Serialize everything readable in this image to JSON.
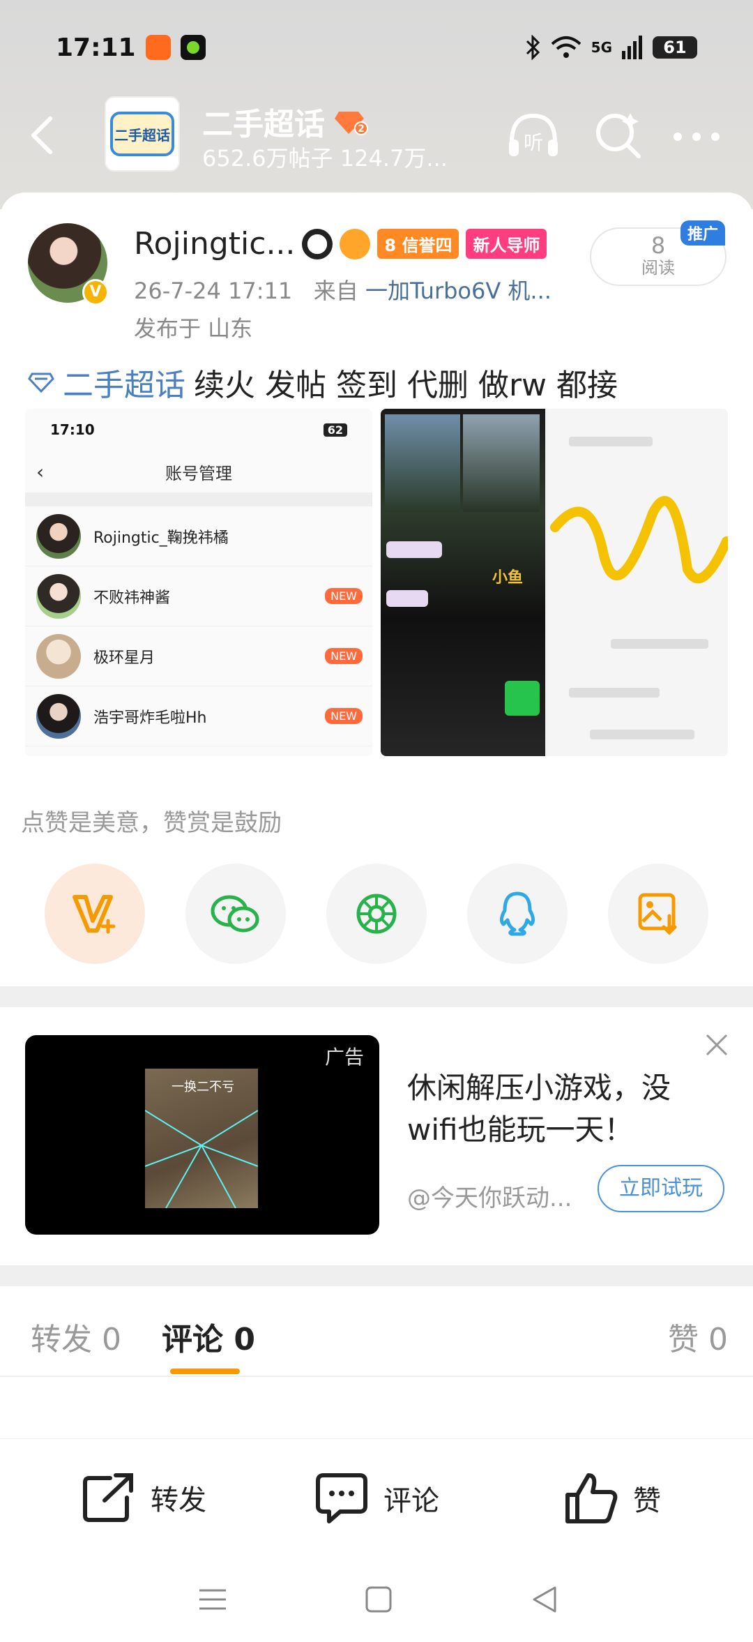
{
  "status": {
    "time": "17:11",
    "network": "5G",
    "battery": "61"
  },
  "topbar": {
    "forum_name": "二手超话",
    "stats": "652.6万帖子 124.7万...",
    "logo_text": "二手超话",
    "level_badge": "2"
  },
  "post": {
    "username": "Rojingtic...",
    "tags": [
      {
        "text": "8 信誉四",
        "color": "#ff8a24"
      },
      {
        "text": "新人导师",
        "color": "#ff3d7f"
      }
    ],
    "time": "26-7-24 17:11",
    "from_label": "来自",
    "device": "一加Turbo6V 机...",
    "location": "发布于 山东",
    "reads_count": "8",
    "reads_label": "阅读",
    "promo_label": "推广",
    "topic": "二手超话",
    "text": "续火 发帖 签到 代删 做rw 都接"
  },
  "screenshot1": {
    "time": "17:10",
    "battery": "62",
    "title": "账号管理",
    "accounts": [
      {
        "name": "Rojingtic_鞠挽祎橘",
        "new": ""
      },
      {
        "name": "不败祎神酱",
        "new": "NEW"
      },
      {
        "name": "极环星月",
        "new": "NEW"
      },
      {
        "name": "浩宇哥炸毛啦Hh",
        "new": "NEW"
      }
    ]
  },
  "screenshot2": {
    "label_1": "小鱼"
  },
  "reward": {
    "text": "点赞是美意，赞赏是鼓励"
  },
  "share_icons": [
    "reward-v-icon",
    "wechat-icon",
    "moments-icon",
    "qq-icon",
    "save-image-icon"
  ],
  "ad": {
    "label": "广告",
    "title": "休闲解压小游戏，没wifi也能玩一天！",
    "source": "@今天你跃动...",
    "cta": "立即试玩",
    "game_caption": "一换二不亏"
  },
  "tabs": {
    "repost": "转发 0",
    "comment": "评论 0",
    "like": "赞 0"
  },
  "actions": {
    "repost": "转发",
    "comment": "评论",
    "like": "赞"
  },
  "colors": {
    "accent": "#f59a00",
    "link": "#4a7fc1",
    "promo": "#2f7de1"
  }
}
